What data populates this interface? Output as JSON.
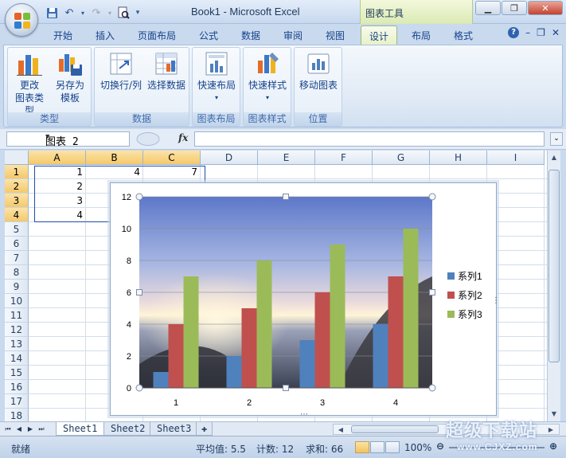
{
  "window": {
    "title": "Book1 - Microsoft Excel",
    "tool_context": "图表工具",
    "buttons": [
      "minimize",
      "restore",
      "close"
    ]
  },
  "ribbon_tabs": [
    {
      "label": "开始",
      "active": false
    },
    {
      "label": "插入",
      "active": false
    },
    {
      "label": "页面布局",
      "active": false
    },
    {
      "label": "公式",
      "active": false
    },
    {
      "label": "数据",
      "active": false
    },
    {
      "label": "审阅",
      "active": false
    },
    {
      "label": "视图",
      "active": false
    },
    {
      "label": "设计",
      "active": true
    },
    {
      "label": "布局",
      "active": false
    },
    {
      "label": "格式",
      "active": false
    }
  ],
  "ribbon_groups": [
    {
      "label": "类型",
      "buttons": [
        {
          "label1": "更改",
          "label2": "图表类型",
          "icon": "change-chart-type-icon"
        },
        {
          "label1": "另存为",
          "label2": "模板",
          "icon": "save-as-template-icon"
        }
      ]
    },
    {
      "label": "数据",
      "buttons": [
        {
          "label1": "切换行/列",
          "label2": "",
          "icon": "switch-row-column-icon"
        },
        {
          "label1": "选择数据",
          "label2": "",
          "icon": "select-data-icon"
        }
      ]
    },
    {
      "label": "图表布局",
      "buttons": [
        {
          "label1": "快速布局",
          "label2": "▾",
          "icon": "quick-layout-icon"
        }
      ]
    },
    {
      "label": "图表样式",
      "buttons": [
        {
          "label1": "快速样式",
          "label2": "▾",
          "icon": "quick-styles-icon"
        }
      ]
    },
    {
      "label": "位置",
      "buttons": [
        {
          "label1": "移动图表",
          "label2": "",
          "icon": "move-chart-icon"
        }
      ]
    }
  ],
  "formula_bar": {
    "name_box": "图表 2",
    "fx": "fx",
    "formula": ""
  },
  "grid": {
    "columns": [
      "A",
      "B",
      "C",
      "D",
      "E",
      "F",
      "G",
      "H",
      "I"
    ],
    "rows": [
      "1",
      "2",
      "3",
      "4",
      "5",
      "6",
      "7",
      "8",
      "9",
      "10",
      "11",
      "12",
      "13",
      "14",
      "15",
      "16",
      "17",
      "18"
    ],
    "cells": {
      "A1": "1",
      "B1": "4",
      "C1": "7",
      "A2": "2",
      "A3": "3",
      "A4": "4"
    }
  },
  "chart_data": {
    "type": "bar",
    "categories": [
      "1",
      "2",
      "3",
      "4"
    ],
    "series": [
      {
        "name": "系列1",
        "values": [
          1,
          2,
          3,
          4
        ],
        "color": "#4f81bd"
      },
      {
        "name": "系列2",
        "values": [
          4,
          5,
          6,
          7
        ],
        "color": "#c0504d"
      },
      {
        "name": "系列3",
        "values": [
          7,
          8,
          9,
          10
        ],
        "color": "#9bbb59"
      }
    ],
    "ylim": [
      0,
      12
    ],
    "yticks": [
      "0",
      "2",
      "4",
      "6",
      "8",
      "10",
      "12"
    ],
    "grid": true,
    "legend": "right",
    "plot_background": "photo-sunset-sea"
  },
  "sheets": [
    {
      "label": "Sheet1",
      "active": true
    },
    {
      "label": "Sheet2",
      "active": false
    },
    {
      "label": "Sheet3",
      "active": false
    }
  ],
  "status": {
    "mode": "就绪",
    "average": "平均值: 5.5",
    "count": "计数: 12",
    "sum": "求和: 66",
    "zoom": "100%"
  },
  "watermark": {
    "line1": "超级下载站",
    "line2": "www.CJXZ.com"
  }
}
